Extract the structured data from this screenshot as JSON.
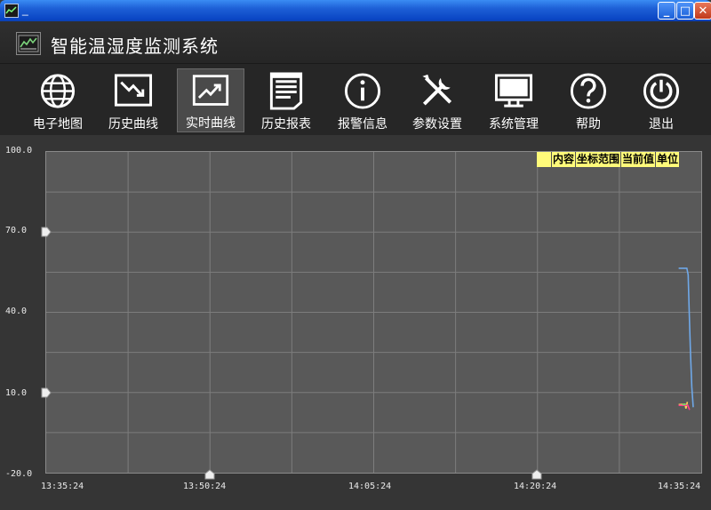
{
  "window": {
    "title": "_",
    "controls": {
      "minimize": "_",
      "maximize": "□",
      "close": "✕"
    }
  },
  "app": {
    "title": "智能温湿度监测系统"
  },
  "toolbar": {
    "items": [
      {
        "label": "电子地图",
        "icon": "globe-icon"
      },
      {
        "label": "历史曲线",
        "icon": "trend-down-chart-icon"
      },
      {
        "label": "实时曲线",
        "icon": "trend-up-chart-icon",
        "active": true
      },
      {
        "label": "历史报表",
        "icon": "report-document-icon"
      },
      {
        "label": "报警信息",
        "icon": "info-icon"
      },
      {
        "label": "参数设置",
        "icon": "tools-icon"
      },
      {
        "label": "系统管理",
        "icon": "monitor-icon"
      },
      {
        "label": "帮助",
        "icon": "help-icon"
      },
      {
        "label": "退出",
        "icon": "power-icon"
      }
    ]
  },
  "chart_data": {
    "type": "line",
    "title": "",
    "xlabel": "",
    "ylabel": "",
    "ylim": [
      -20.0,
      100.0
    ],
    "yticks": [
      "100.0",
      "70.0",
      "40.0",
      "10.0",
      "-20.0"
    ],
    "xticks": [
      "13:35:24",
      "13:50:24",
      "14:05:24",
      "14:20:24",
      "14:35:24"
    ],
    "grid": true,
    "legend_columns": [
      "",
      "内容",
      "坐标范围",
      "当前值",
      "单位"
    ],
    "series": [
      {
        "color": "#6fa8e8",
        "points": [
          [
            "14:33:20",
            56.5
          ],
          [
            "14:34:05",
            56.5
          ],
          [
            "14:34:12",
            54.0
          ],
          [
            "14:34:18",
            40.0
          ],
          [
            "14:34:25",
            25.0
          ],
          [
            "14:34:32",
            12.0
          ],
          [
            "14:34:40",
            4.5
          ]
        ]
      },
      {
        "color": "#ffd35a",
        "points": [
          [
            "14:33:20",
            5.5
          ],
          [
            "14:33:55",
            5.6
          ],
          [
            "14:34:00",
            4.0
          ],
          [
            "14:34:08",
            6.5
          ]
        ]
      },
      {
        "color": "#ff3d8a",
        "points": [
          [
            "14:33:20",
            5.2
          ],
          [
            "14:34:10",
            5.2
          ],
          [
            "14:34:20",
            3.5
          ]
        ]
      },
      {
        "color": "#6fd66f",
        "points": [
          [
            "14:33:40",
            5.5
          ],
          [
            "14:34:00",
            5.5
          ]
        ]
      }
    ],
    "colors": {
      "plot_bg": "#595959",
      "grid": "#7d7d7d",
      "legend_bg": "#fffb7a"
    }
  }
}
